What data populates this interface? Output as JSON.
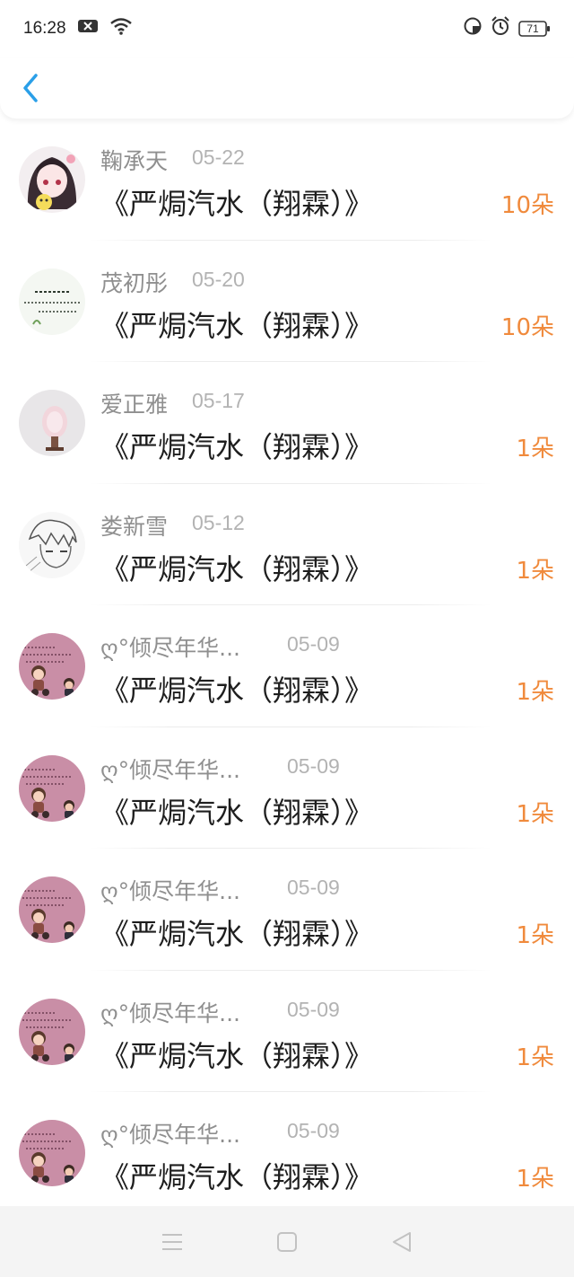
{
  "status_bar": {
    "time": "16:28",
    "battery": "71",
    "icons": [
      "notification-x-icon",
      "wifi-icon",
      "data-saver-icon",
      "alarm-icon",
      "battery-icon"
    ]
  },
  "header": {
    "back_icon": "chevron-left-icon"
  },
  "colors": {
    "accent": "#2a9fe8",
    "amount": "#f08a3c",
    "name": "#8f8f8f",
    "date": "#b3b3b3"
  },
  "gifts": [
    {
      "name": "鞠承天",
      "date": "05-22",
      "title": "《严焗汽水（翔霖）》",
      "amount": "10朵",
      "avatar": "anime-girl-avatar"
    },
    {
      "name": "茂初彤",
      "date": "05-20",
      "title": "《严焗汽水（翔霖）》",
      "amount": "10朵",
      "avatar": "calligraphy-avatar"
    },
    {
      "name": "爱正雅",
      "date": "05-17",
      "title": "《严焗汽水（翔霖）》",
      "amount": "1朵",
      "avatar": "pink-bottle-avatar"
    },
    {
      "name": "娄新雪",
      "date": "05-12",
      "title": "《严焗汽水（翔霖）》",
      "amount": "1朵",
      "avatar": "sketch-boy-avatar"
    },
    {
      "name": "ღ°倾尽年华...",
      "date": "05-09",
      "title": "《严焗汽水（翔霖）》",
      "amount": "1朵",
      "avatar": "pink-cartoon-avatar"
    },
    {
      "name": "ღ°倾尽年华...",
      "date": "05-09",
      "title": "《严焗汽水（翔霖）》",
      "amount": "1朵",
      "avatar": "pink-cartoon-avatar"
    },
    {
      "name": "ღ°倾尽年华...",
      "date": "05-09",
      "title": "《严焗汽水（翔霖）》",
      "amount": "1朵",
      "avatar": "pink-cartoon-avatar"
    },
    {
      "name": "ღ°倾尽年华...",
      "date": "05-09",
      "title": "《严焗汽水（翔霖）》",
      "amount": "1朵",
      "avatar": "pink-cartoon-avatar"
    },
    {
      "name": "ღ°倾尽年华...",
      "date": "05-09",
      "title": "《严焗汽水（翔霖）》",
      "amount": "1朵",
      "avatar": "pink-cartoon-avatar"
    }
  ],
  "nav_bar": {
    "icons": [
      "menu-icon",
      "home-square-icon",
      "back-triangle-icon"
    ]
  }
}
